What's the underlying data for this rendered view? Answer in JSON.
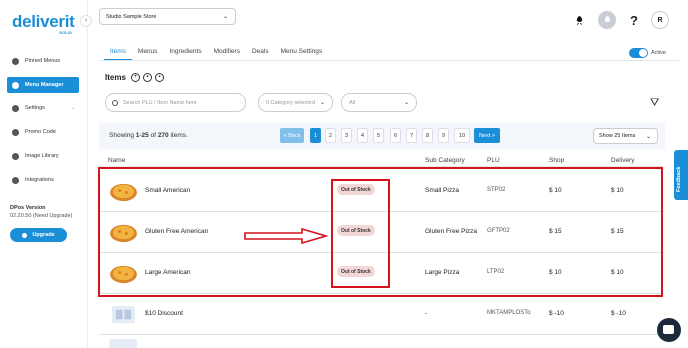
{
  "brand": {
    "name": "deliverit",
    "sub": "GOLIO",
    "accent": "#1a8fd8"
  },
  "sidebar": {
    "collapse_icon": "‹",
    "items": [
      {
        "label": "Pinned Menus",
        "icon": "pin-icon"
      },
      {
        "label": "Menu Manager",
        "icon": "menu-icon",
        "active": true
      },
      {
        "label": "Settings",
        "icon": "gear-icon",
        "has_chevron": true
      },
      {
        "label": "Promo Code",
        "icon": "tag-icon"
      },
      {
        "label": "Image Library",
        "icon": "image-icon"
      },
      {
        "label": "Integrations",
        "icon": "plug-icon"
      }
    ],
    "version_title": "DPos Version",
    "version_value": "02.20.50 (Need Upgrade)",
    "upgrade_label": "Upgrade"
  },
  "header": {
    "store": "Studio Sample Store",
    "avatar": "R",
    "icons": [
      "rocket-icon",
      "rocket-alt-icon",
      "help-icon",
      "avatar"
    ]
  },
  "tabs": [
    "Items",
    "Menus",
    "Ingredients",
    "Modifiers",
    "Deals",
    "Menu Settings"
  ],
  "active_toggle_label": "Active",
  "items_title": "Items",
  "search": {
    "placeholder": "Search PLU / Item Name here"
  },
  "category_dropdown": "0 Category selected",
  "status_dropdown": "All",
  "pagination": {
    "showing_prefix": "Showing ",
    "range": "1-25",
    "of": " of ",
    "total": "270",
    "suffix": " items.",
    "back": "< Back",
    "pages": [
      "1",
      "2",
      "3",
      "4",
      "5",
      "6",
      "7",
      "8",
      "9",
      "10"
    ],
    "current": "1",
    "next": "Next >",
    "per_page": "Show 25 Items"
  },
  "table": {
    "columns": [
      "Name",
      "Sub Category",
      "PLU",
      "Shop",
      "Delivery"
    ],
    "rows": [
      {
        "name": "Small American",
        "status": "Out of Stock",
        "sub_category": "Small Pizza",
        "plu": "STP02",
        "shop": "$ 10",
        "delivery": "$ 10",
        "thumb": "pizza"
      },
      {
        "name": "Gluten Free American",
        "status": "Out of Stock",
        "sub_category": "Gluten Free Pizza",
        "plu": "GFTP02",
        "shop": "$ 15",
        "delivery": "$ 15",
        "thumb": "pizza"
      },
      {
        "name": "Large American",
        "status": "Out of Stock",
        "sub_category": "Large Pizza",
        "plu": "LTP02",
        "shop": "$ 10",
        "delivery": "$ 10",
        "thumb": "pizza"
      },
      {
        "name": "$10 Discount",
        "status": "",
        "sub_category": "-",
        "plu": "MKTAMPLOSTo",
        "shop": "$ -10",
        "delivery": "$ -10",
        "thumb": "discount"
      }
    ]
  },
  "feedback_label": "Feedback",
  "annotation_color": "#d6121e"
}
